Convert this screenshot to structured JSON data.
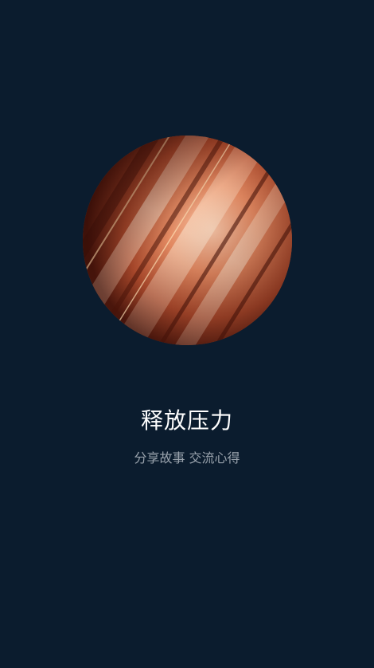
{
  "splash": {
    "title": "释放压力",
    "subtitle": "分享故事 交流心得",
    "background_color": "#0b1c2e",
    "hero_image": "abstract-copper-silk-disc"
  }
}
